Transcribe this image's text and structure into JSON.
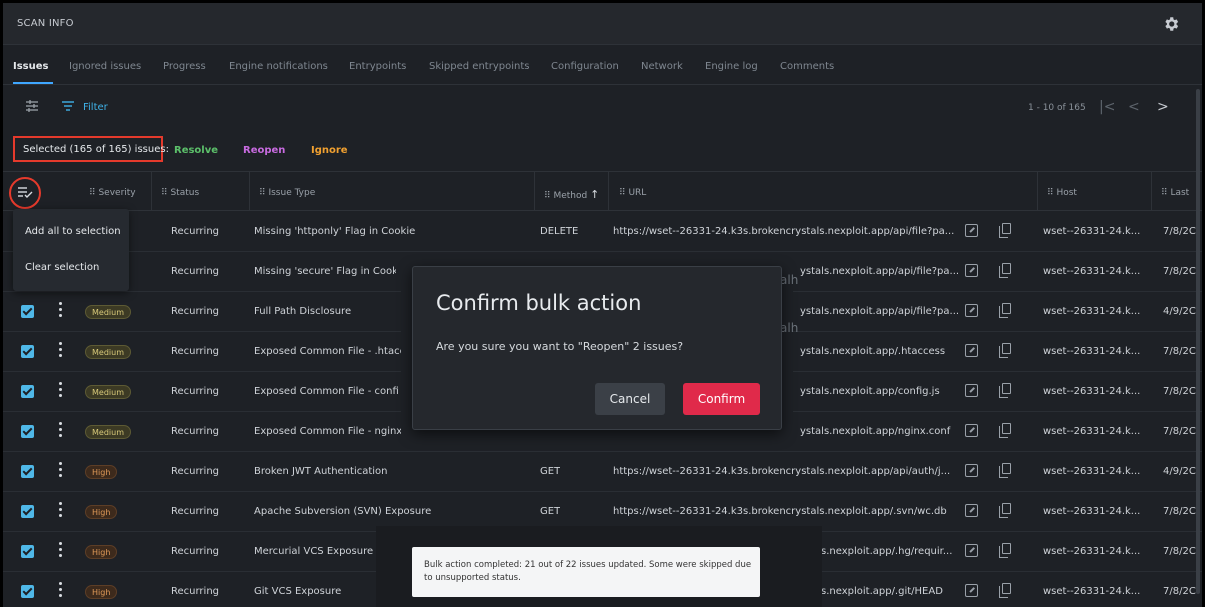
{
  "header": {
    "title": "SCAN INFO"
  },
  "tabs": [
    {
      "label": "Issues"
    },
    {
      "label": "Ignored issues"
    },
    {
      "label": "Progress"
    },
    {
      "label": "Engine notifications"
    },
    {
      "label": "Entrypoints"
    },
    {
      "label": "Skipped entrypoints"
    },
    {
      "label": "Configuration"
    },
    {
      "label": "Network"
    },
    {
      "label": "Engine log"
    },
    {
      "label": "Comments"
    }
  ],
  "toolbar": {
    "filter_label": "Filter"
  },
  "pager": {
    "range": "1 - 10 of 165"
  },
  "selection": {
    "text": "Selected (165 of 165) issues:",
    "resolve": "Resolve",
    "reopen": "Reopen",
    "ignore": "Ignore"
  },
  "columns": {
    "severity": "Severity",
    "status": "Status",
    "issue_type": "Issue Type",
    "method": "Method",
    "url": "URL",
    "host": "Host",
    "last": "Last"
  },
  "menu": {
    "add_all": "Add all to selection",
    "clear": "Clear selection"
  },
  "rows": [
    {
      "severity": "",
      "status": "Recurring",
      "type": "Missing 'httponly' Flag in Cookie",
      "method": "DELETE",
      "url": "https://wset--26331-24.k3s.brokencrystals.nexploit.app/api/file?pa...",
      "host": "wset--26331-24.k...",
      "last": "7/8/2C"
    },
    {
      "severity": "",
      "status": "Recurring",
      "type": "Missing 'secure' Flag in Cookie",
      "method": "",
      "url": "ystals.nexploit.app/api/file?pa...",
      "host": "wset--26331-24.k...",
      "last": "7/8/2C"
    },
    {
      "severity": "Medium",
      "status": "Recurring",
      "type": "Full Path Disclosure",
      "method": "",
      "url": "ystals.nexploit.app/api/file?pa...",
      "host": "wset--26331-24.k...",
      "last": "4/9/2C"
    },
    {
      "severity": "Medium",
      "status": "Recurring",
      "type": "Exposed Common File - .htacc",
      "method": "",
      "url": "ystals.nexploit.app/.htaccess",
      "host": "wset--26331-24.k...",
      "last": "7/8/2C"
    },
    {
      "severity": "Medium",
      "status": "Recurring",
      "type": "Exposed Common File - confi",
      "method": "",
      "url": "ystals.nexploit.app/config.js",
      "host": "wset--26331-24.k...",
      "last": "7/8/2C"
    },
    {
      "severity": "Medium",
      "status": "Recurring",
      "type": "Exposed Common File - nginx",
      "method": "",
      "url": "ystals.nexploit.app/nginx.conf",
      "host": "wset--26331-24.k...",
      "last": "7/8/2C"
    },
    {
      "severity": "High",
      "status": "Recurring",
      "type": "Broken JWT Authentication",
      "method": "GET",
      "url": "https://wset--26331-24.k3s.brokencrystals.nexploit.app/api/auth/j...",
      "host": "wset--26331-24.k...",
      "last": "4/9/2C"
    },
    {
      "severity": "High",
      "status": "Recurring",
      "type": "Apache Subversion (SVN) Exposure",
      "method": "GET",
      "url": "https://wset--26331-24.k3s.brokencrystals.nexploit.app/.svn/wc.db",
      "host": "wset--26331-24.k...",
      "last": "7/8/2C"
    },
    {
      "severity": "High",
      "status": "Recurring",
      "type": "Mercurial VCS Exposure",
      "method": "",
      "url": "s.nexploit.app/.hg/requir...",
      "host": "wset--26331-24.k...",
      "last": "7/8/2C"
    },
    {
      "severity": "High",
      "status": "Recurring",
      "type": "Git VCS Exposure",
      "method": "",
      "url": "s.nexploit.app/.git/HEAD",
      "host": "wset--26331-24.k...",
      "last": "7/8/2C"
    }
  ],
  "modal": {
    "title": "Confirm bulk action",
    "body": "Are you sure you want to \"Reopen\" 2 issues?",
    "cancel": "Cancel",
    "confirm": "Confirm",
    "ghost": "alh"
  },
  "toast": {
    "text": "Bulk action completed: 21 out of 22 issues updated. Some were skipped due to unsupported status."
  },
  "colors": {
    "accent": "#3fb2e8",
    "confirm": "#e02a4a",
    "resolve": "#5cc06a",
    "reopen": "#c86be0",
    "ignore": "#f0a030",
    "highlight": "#e53a2c"
  }
}
